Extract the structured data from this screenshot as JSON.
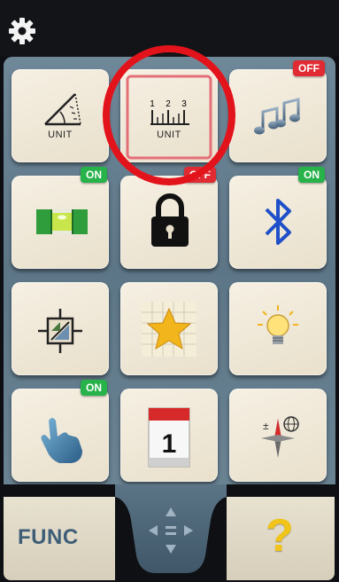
{
  "topbar": {
    "settings_icon": "gear-icon"
  },
  "tiles": [
    {
      "id": "angle-unit",
      "icon": "angle-icon",
      "label": "UNIT",
      "badge": ""
    },
    {
      "id": "length-unit",
      "icon": "ruler-icon",
      "label": "UNIT",
      "ruler_numbers": [
        "1",
        "2",
        "3"
      ],
      "badge": ""
    },
    {
      "id": "sound",
      "icon": "music-notes-icon",
      "badge": "OFF"
    },
    {
      "id": "level",
      "icon": "spirit-level-icon",
      "badge": "ON"
    },
    {
      "id": "lock",
      "icon": "padlock-icon",
      "badge": "OFF"
    },
    {
      "id": "bluetooth",
      "icon": "bluetooth-icon",
      "badge": "ON"
    },
    {
      "id": "target",
      "icon": "crosshair-target-icon",
      "badge": ""
    },
    {
      "id": "favorites",
      "icon": "star-icon",
      "badge": ""
    },
    {
      "id": "light",
      "icon": "light-bulb-icon",
      "badge": ""
    },
    {
      "id": "touch",
      "icon": "hand-pointer-icon",
      "badge": "ON"
    },
    {
      "id": "calendar",
      "icon": "calendar-icon",
      "calendar_day": "1",
      "badge": ""
    },
    {
      "id": "location",
      "icon": "compass-globe-icon",
      "badge": ""
    }
  ],
  "bottom": {
    "func_label": "FUNC",
    "move_icon": "move-arrows-icon",
    "help_label": "?"
  },
  "colors": {
    "badge_on": "#27b24a",
    "badge_off": "#e02b32",
    "highlight_ring": "#e3131b",
    "func_text": "#3e5d77",
    "help_mark": "#f0c419"
  }
}
